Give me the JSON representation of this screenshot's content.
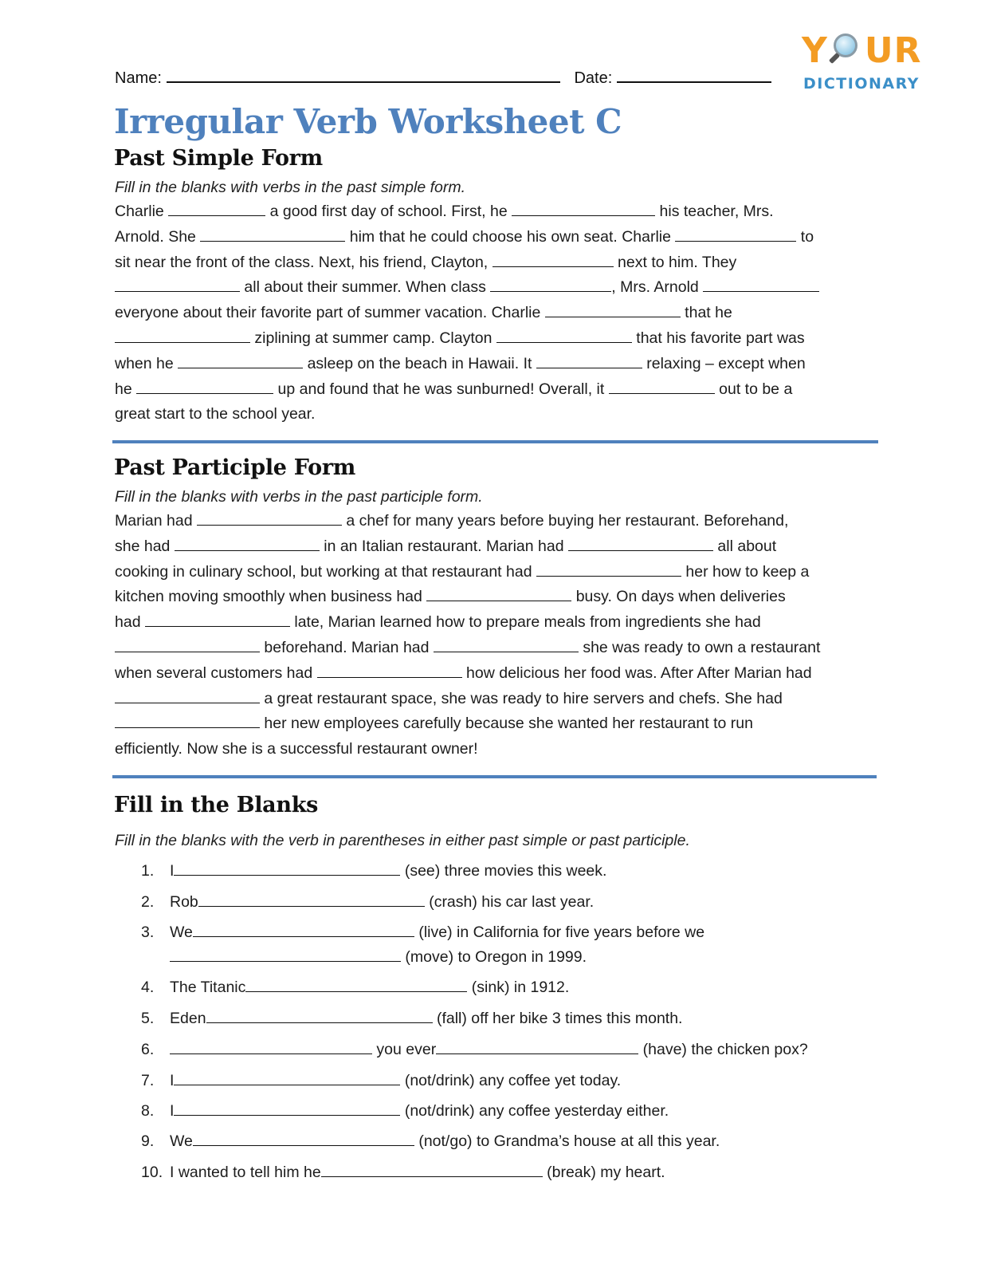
{
  "header": {
    "name_label": "Name:",
    "date_label": "Date:"
  },
  "logo": {
    "top_y": "Y",
    "top_rest": "UR",
    "bottom": "DICTIONARY",
    "colors": {
      "orange": "#f39c24",
      "blue": "#3b8fc8"
    }
  },
  "title": "Irregular Verb Worksheet C",
  "accent_color": "#4f81bd",
  "sections": {
    "past_simple": {
      "heading": "Past Simple Form",
      "instruction": "Fill in the blanks with verbs in the past simple form.",
      "lines": [
        [
          "Charlie ",
          "_",
          " a good first day of school. First, he ",
          "_",
          " his teacher, Mrs."
        ],
        [
          "Arnold. She ",
          "_",
          " him that he could choose his own seat. Charlie ",
          "_",
          " to"
        ],
        [
          "sit near the front of the class. Next, his friend, Clayton, ",
          "_",
          " next to him. They"
        ],
        [
          "_",
          " all about their summer. When class ",
          "_",
          ", Mrs. Arnold ",
          "_"
        ],
        [
          "everyone about their favorite part of summer vacation. Charlie ",
          "_",
          " that he"
        ],
        [
          "_",
          " ziplining at summer camp. Clayton ",
          "_",
          " that his favorite part was"
        ],
        [
          "when he ",
          "_",
          " asleep on the beach in Hawaii. It ",
          "_",
          " relaxing – except when"
        ],
        [
          "he ",
          "_",
          " up and found that he was sunburned! Overall, it ",
          "_",
          " out to be a"
        ],
        [
          "great start to the school year."
        ]
      ]
    },
    "past_participle": {
      "heading": "Past Participle Form",
      "instruction": "Fill in the blanks with verbs in the past participle form.",
      "lines": [
        [
          "Marian had ",
          "_",
          " a chef for many years before buying her restaurant. Beforehand,"
        ],
        [
          "she had ",
          "_",
          " in an Italian restaurant. Marian had ",
          "_",
          " all about"
        ],
        [
          "cooking in culinary school, but working at that restaurant had ",
          "_",
          " her how to keep a"
        ],
        [
          "kitchen moving smoothly when business had ",
          "_",
          " busy. On days when deliveries"
        ],
        [
          "had ",
          "_",
          " late, Marian learned how to prepare meals from ingredients she had"
        ],
        [
          "_",
          " beforehand. Marian had ",
          "_",
          " she was ready to own a restaurant"
        ],
        [
          "when several customers had ",
          "_",
          " how delicious her food was. After After Marian had"
        ],
        [
          "_",
          " a great restaurant space, she was ready to hire servers and chefs. She had"
        ],
        [
          "_",
          " her new employees carefully because she wanted her restaurant to run"
        ],
        [
          "efficiently. Now she is a successful restaurant owner!"
        ]
      ]
    },
    "fill_blanks": {
      "heading": "Fill in the Blanks",
      "instruction": "Fill in the blanks with the verb in parentheses in either past simple or past participle.",
      "items": [
        {
          "num": "1.",
          "before": "I",
          "after": " (see) three movies this week."
        },
        {
          "num": "2.",
          "before": "Rob",
          "after": " (crash) his car last year."
        },
        {
          "num": "3.",
          "before": "We",
          "after": " (live) in California for five years before we",
          "line2_after": " (move) to Oregon in 1999."
        },
        {
          "num": "4.",
          "before": "The Titanic",
          "after": " (sink) in 1912."
        },
        {
          "num": "5.",
          "before": "Eden",
          "after": " (fall) off her bike 3 times this month."
        },
        {
          "num": "6.",
          "before": "",
          "middle": " you ever",
          "after": " (have) the chicken pox?"
        },
        {
          "num": "7.",
          "before": "I",
          "after": " (not/drink) any coffee yet today."
        },
        {
          "num": "8.",
          "before": "I",
          "after": " (not/drink) any coffee yesterday either."
        },
        {
          "num": "9.",
          "before": "We",
          "after": " (not/go) to Grandma’s house at all this year."
        },
        {
          "num": "10.",
          "before": "I wanted to tell him he",
          "after": " (break) my heart."
        }
      ]
    }
  }
}
